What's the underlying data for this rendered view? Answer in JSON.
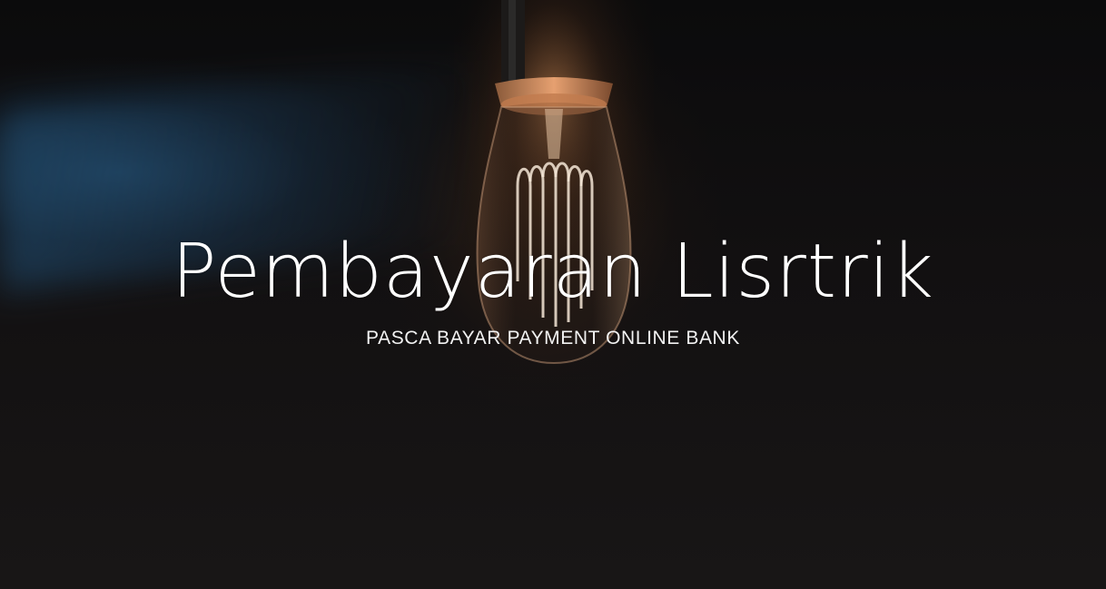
{
  "hero": {
    "title": "Pembayaran Lisrtrik",
    "subtitle": "PASCA BAYAR PAYMENT ONLINE BANK",
    "background_image": "light-bulb-photo"
  },
  "colors": {
    "background": "#141212",
    "text": "#ffffff",
    "bulb_glow": "#e08a4a",
    "blue_tint": "#23557d"
  }
}
